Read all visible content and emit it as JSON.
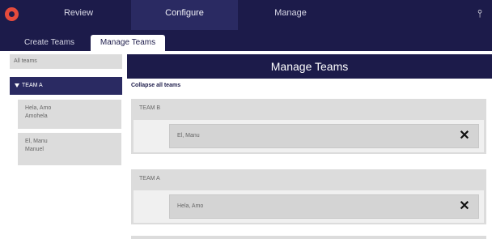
{
  "topnav": {
    "tabs": [
      "Review",
      "Configure",
      "Manage"
    ],
    "active_tab": "Configure",
    "logo": "app-logo",
    "pin_icon": "pin-icon"
  },
  "subnav": {
    "tabs": [
      "Create Teams",
      "Manage Teams"
    ],
    "active_tab": "Manage Teams"
  },
  "sidebar": {
    "all_teams_label": "All teams",
    "selected_team": "TEAM A",
    "members": [
      {
        "line1": "Hela, Amo",
        "line2": "Amohela"
      },
      {
        "line1": "El, Manu",
        "line2": "Manuel"
      }
    ]
  },
  "main": {
    "title": "Manage Teams",
    "collapse_all_label": "Collapse all teams",
    "teams": [
      {
        "name": "TEAM B",
        "members": [
          "El, Manu"
        ]
      },
      {
        "name": "TEAM A",
        "members": [
          "Hela, Amo"
        ]
      }
    ],
    "remove_symbol": "✕"
  },
  "colors": {
    "nav_bg": "#1c1b4a",
    "active_tab_bg": "#2a2a62",
    "logo_accent": "#e54b3c",
    "card_bg": "#dcdcdc"
  }
}
